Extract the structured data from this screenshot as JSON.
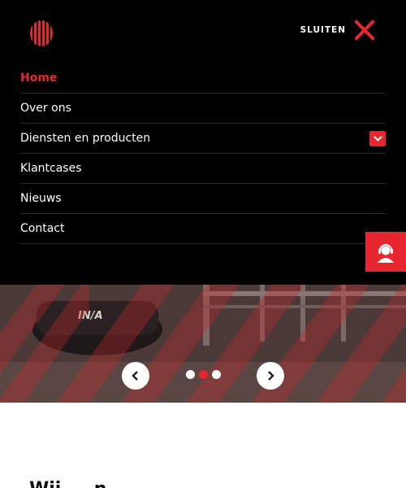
{
  "header": {
    "logo_icon": "striped-circle-logo",
    "close_label": "SLUITEN",
    "close_icon": "close-x-icon"
  },
  "nav": {
    "items": [
      {
        "label": "Home",
        "active": true
      },
      {
        "label": "Over ons",
        "active": false
      },
      {
        "label": "Diensten en producten",
        "active": false,
        "expandable": true
      },
      {
        "label": "Klantcases",
        "active": false
      },
      {
        "label": "Nieuws",
        "active": false
      },
      {
        "label": "Contact",
        "active": false
      }
    ],
    "expand_icon": "chevron-down-icon"
  },
  "support_button": {
    "icon": "headset-agent-icon"
  },
  "hero": {
    "prev_icon": "chevron-left-icon",
    "next_icon": "chevron-right-icon",
    "slide_count": 3,
    "active_slide": 2
  },
  "section": {
    "heading_partial": "Wij ... n"
  },
  "colors": {
    "accent": "#e8262f",
    "menu_bg": "#000000",
    "text": "#ffffff"
  }
}
